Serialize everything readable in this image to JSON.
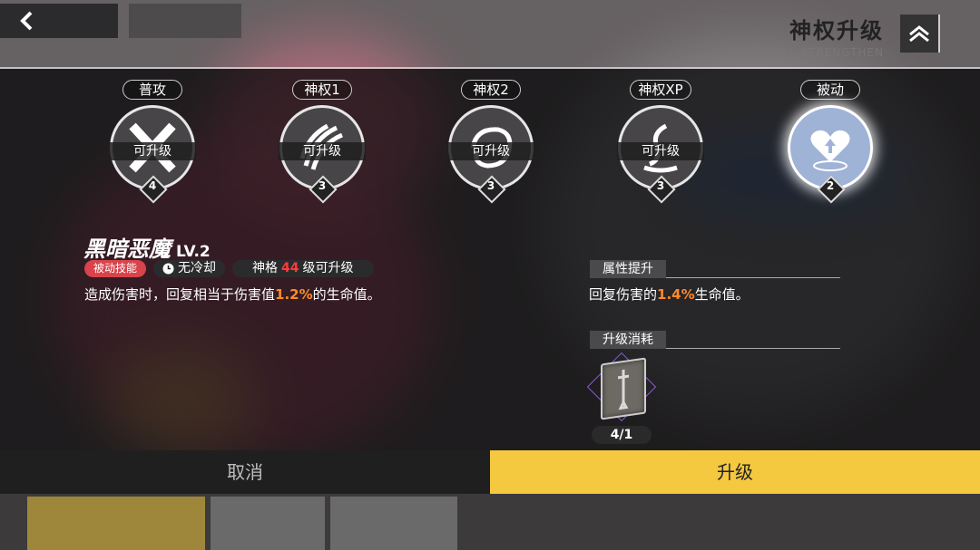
{
  "header": {
    "title": "神权升级",
    "subtitle": "SKILL STRENGTHEN"
  },
  "skills": [
    {
      "label": "普攻",
      "status": "可升级",
      "level": "4",
      "icon": "x-cross-icon"
    },
    {
      "label": "神权1",
      "status": "可升级",
      "level": "3",
      "icon": "claw-slash-icon"
    },
    {
      "label": "神权2",
      "status": "可升级",
      "level": "3",
      "icon": "swirl-icon"
    },
    {
      "label": "神权XP",
      "status": "可升级",
      "level": "3",
      "icon": "vortex-icon"
    },
    {
      "label": "被动",
      "status": "",
      "level": "2",
      "icon": "heart-up-icon",
      "selected": true
    }
  ],
  "detail": {
    "name": "黑暗恶魔",
    "level": "LV.2",
    "tag_type": "被动技能",
    "cooldown": "无冷却",
    "req_prefix": "神格",
    "req_level": "44",
    "req_suffix": "级可升级",
    "desc_prefix": "造成伤害时，回复相当于伤害值",
    "desc_value": "1.2%",
    "desc_suffix": "的生命值。"
  },
  "upgrade": {
    "section_title": "属性提升",
    "desc_prefix": "回复伤害的",
    "desc_value": "1.4%",
    "desc_suffix": "生命值。"
  },
  "cost": {
    "section_title": "升级消耗",
    "item_icon": "sword-book-icon",
    "count": "4/1"
  },
  "buttons": {
    "cancel": "取消",
    "confirm": "升级"
  },
  "colors": {
    "accent": "#f4c83f",
    "highlight": "#ff8a2a",
    "tag_red": "#d9434b"
  }
}
